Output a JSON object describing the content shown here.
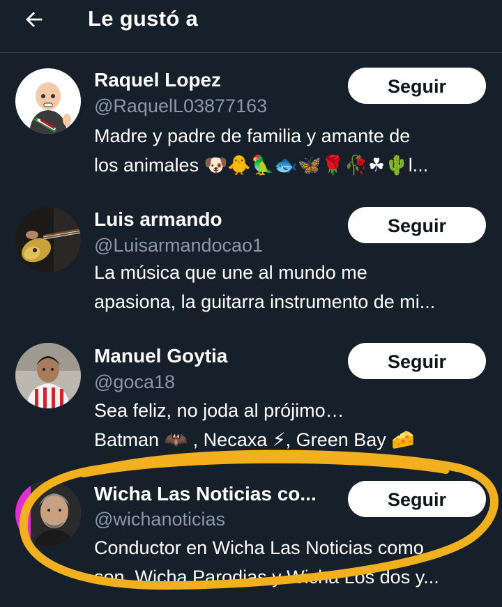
{
  "header": {
    "title": "Le gustó a"
  },
  "users": [
    {
      "name": "Raquel Lopez",
      "handle": "@RaquelL03877163",
      "bio": [
        "Madre y padre de familia y amante de",
        "los animales 🐶🐥🦜🐟🦋🌹🥀☘🌵l..."
      ],
      "follow_label": "Seguir"
    },
    {
      "name": "Luis armando",
      "handle": "@Luisarmandocao1",
      "bio": [
        "La música que une al mundo me",
        "apasiona, la guitarra instrumento de mi..."
      ],
      "follow_label": "Seguir"
    },
    {
      "name": "Manuel Goytia",
      "handle": "@goca18",
      "bio": [
        "Sea feliz, no joda al prójimo…",
        "Batman 🦇 , Necaxa ⚡, Green Bay 🧀"
      ],
      "follow_label": "Seguir"
    },
    {
      "name": "Wicha Las Noticias co...",
      "handle": "@wichanoticias",
      "bio": [
        "Conductor en Wicha Las Noticias como",
        "son, Wicha Parodias y Wicha Los dos y..."
      ],
      "follow_label": "Seguir"
    }
  ],
  "colors": {
    "background": "#15202b",
    "muted_text": "#8b98a5",
    "highlight": "#f2b01e"
  },
  "icons": {
    "back": "arrow-left-icon"
  }
}
